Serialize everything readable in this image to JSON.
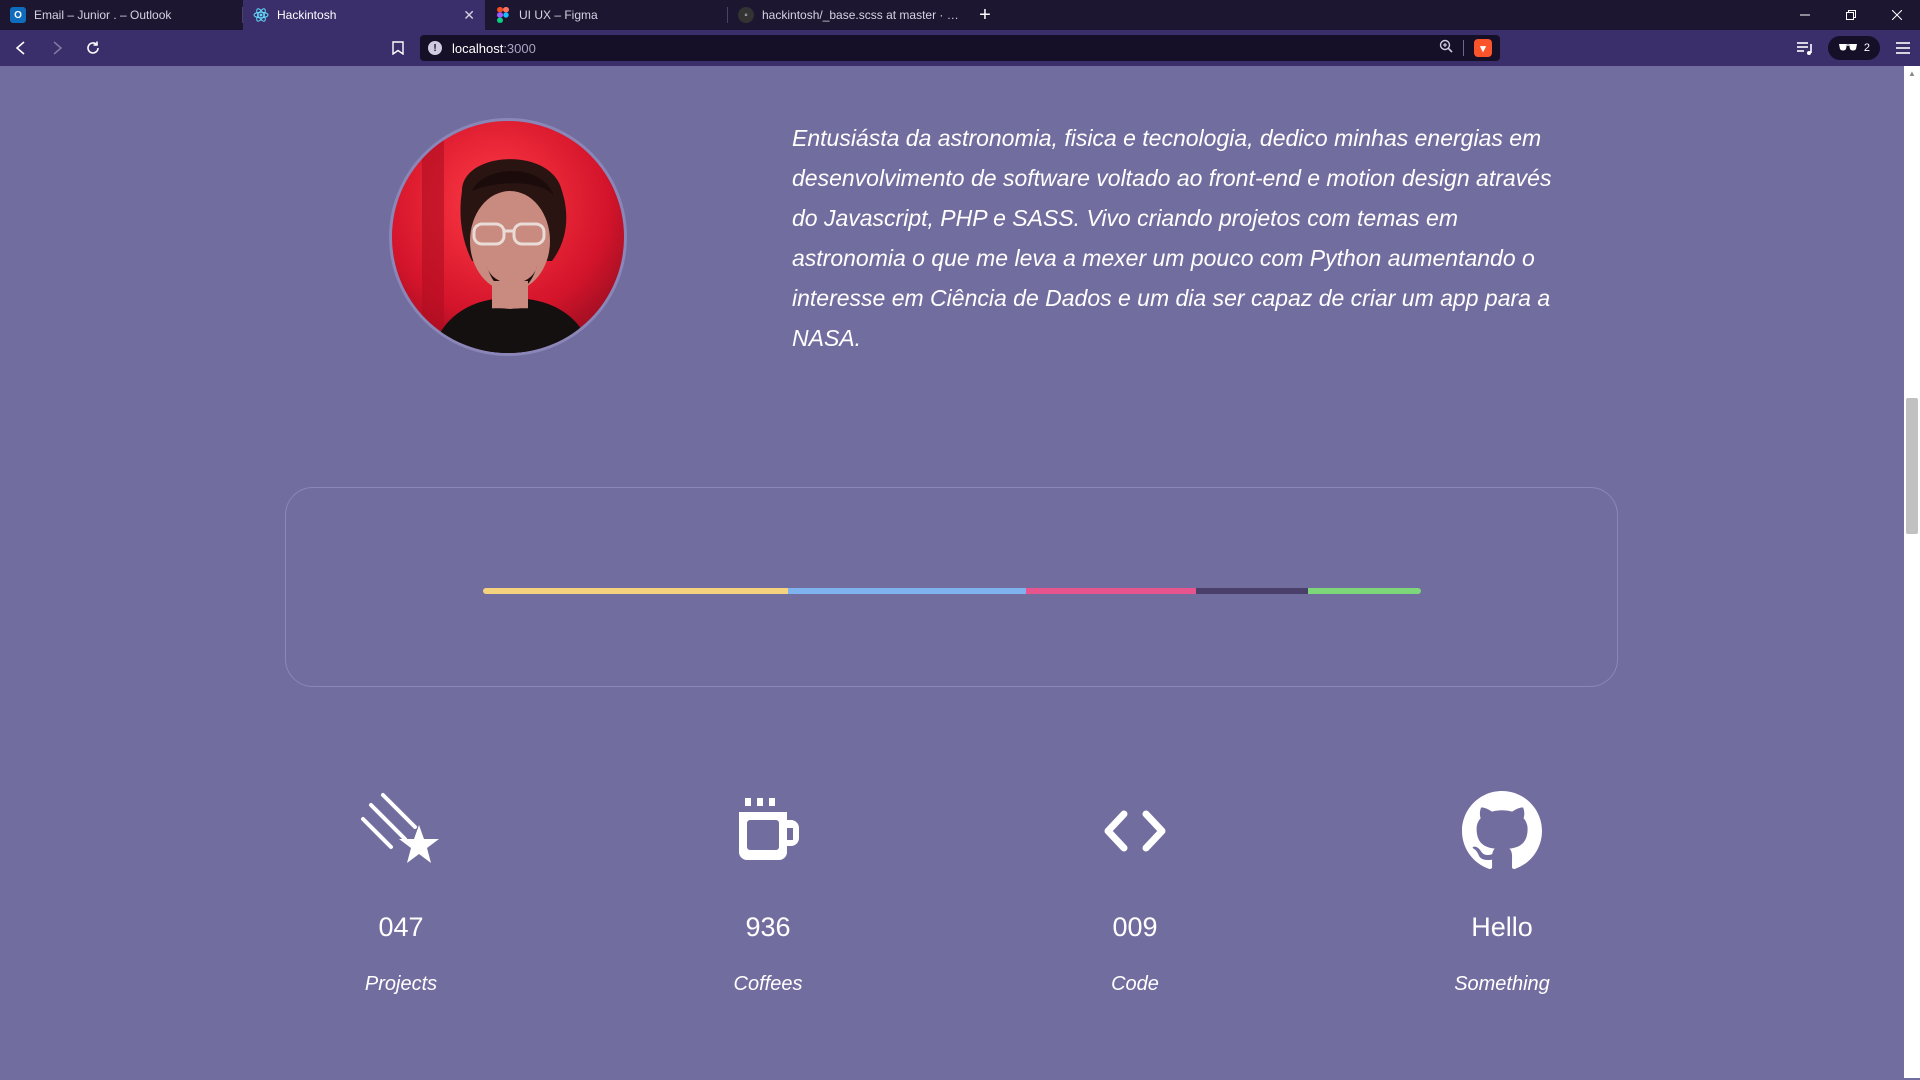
{
  "browser": {
    "tabs": [
      {
        "label": "Email – Junior . – Outlook",
        "icon": "outlook-icon",
        "color": "#0f6cbd",
        "active": false
      },
      {
        "label": "Hackintosh",
        "icon": "react-icon",
        "color": "#61dafb",
        "active": true
      },
      {
        "label": "UI UX – Figma",
        "icon": "figma-icon",
        "color": "#f24e1e",
        "active": false
      },
      {
        "label": "hackintosh/_base.scss at master · junio",
        "icon": "github-icon",
        "color": "#333333",
        "active": false
      }
    ],
    "url_host": "localhost",
    "url_port": ":3000",
    "profile_count": "2"
  },
  "profile": {
    "bio": "Entusiásta da astronomia, fisica e tecnologia, dedico minhas energias em desenvolvimento de software voltado ao front-end e motion design através do Javascript, PHP e SASS. Vivo criando projetos com temas em astronomia o que me leva a mexer um pouco com Python aumentando o interesse em Ciência de Dados e um dia ser capaz de criar um app para a NASA."
  },
  "languages": {
    "segments": [
      {
        "share": 0.325,
        "color": "#f5d27e"
      },
      {
        "share": 0.254,
        "color": "#7fb3f0"
      },
      {
        "share": 0.181,
        "color": "#e8548d"
      },
      {
        "share": 0.12,
        "color": "#4a3f6a"
      },
      {
        "share": 0.12,
        "color": "#7ed67b"
      }
    ]
  },
  "stats": [
    {
      "icon": "shooting-star-icon",
      "number": "047",
      "label": "Projects"
    },
    {
      "icon": "coffee-cup-icon",
      "number": "936",
      "label": "Coffees"
    },
    {
      "icon": "code-brackets-icon",
      "number": "009",
      "label": "Code"
    },
    {
      "icon": "github-icon",
      "number": "Hello",
      "label": "Something"
    }
  ]
}
